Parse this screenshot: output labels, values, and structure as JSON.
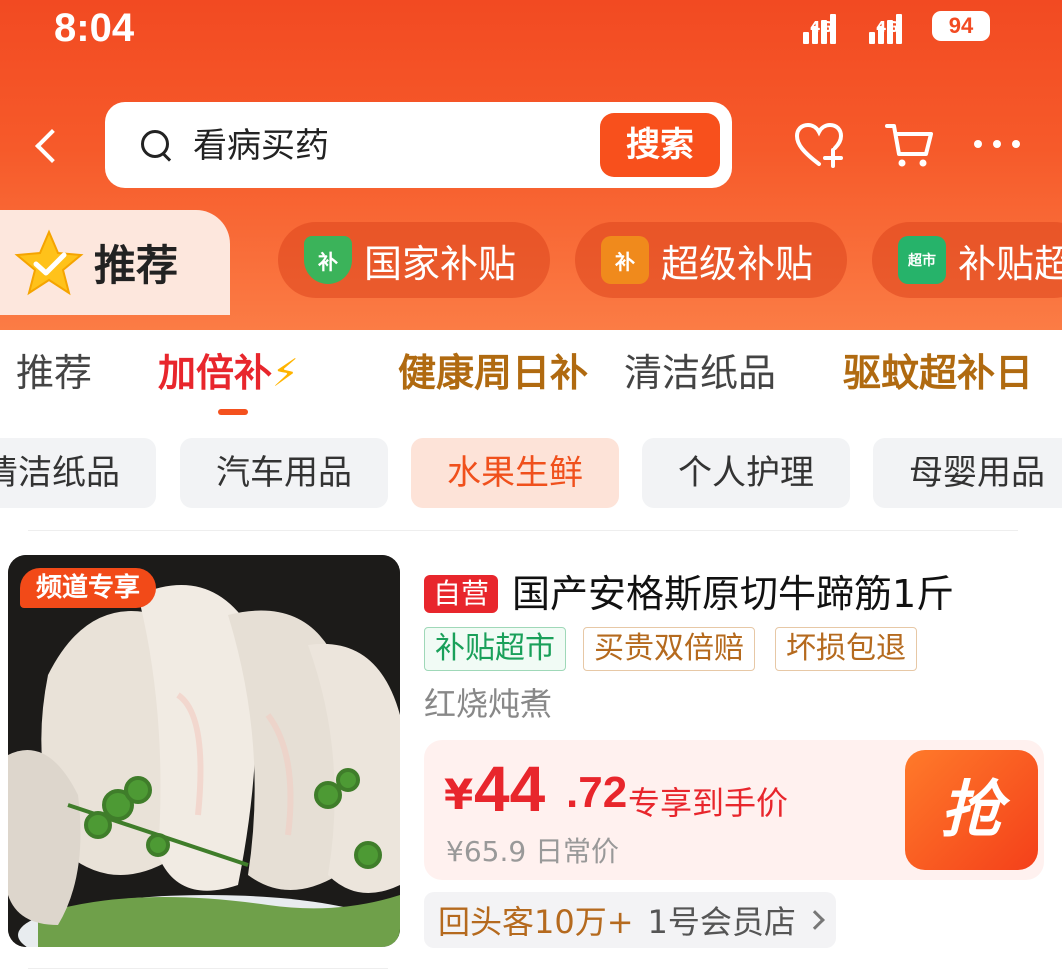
{
  "status": {
    "time": "8:04",
    "network1": "4G",
    "network2": "4G",
    "battery": "94"
  },
  "search": {
    "query": "看病买药",
    "button": "搜索"
  },
  "channels": [
    {
      "label": "推荐",
      "icon": "star-check-icon",
      "active": true
    },
    {
      "label": "国家补贴",
      "icon": "shield-icon",
      "icon_text": "补"
    },
    {
      "label": "超级补贴",
      "icon": "gift-icon",
      "icon_text": "补"
    },
    {
      "label": "补贴超",
      "icon": "basket-icon",
      "icon_text": "超市"
    }
  ],
  "subtabs": [
    {
      "label": "推荐"
    },
    {
      "label": "加倍补"
    },
    {
      "label": "健康周日补"
    },
    {
      "label": "清洁纸品"
    },
    {
      "label": "驱蚊超补日"
    }
  ],
  "chips": [
    {
      "label": "清洁纸品"
    },
    {
      "label": "汽车用品"
    },
    {
      "label": "水果生鲜"
    },
    {
      "label": "个人护理"
    },
    {
      "label": "母婴用品"
    }
  ],
  "product": {
    "channel_badge": "频道专享",
    "self_badge": "自营",
    "title": "国产安格斯原切牛蹄筋1斤",
    "tags": [
      "补贴超市",
      "买贵双倍赔",
      "坏损包退"
    ],
    "subtitle": "红烧炖煮",
    "price_currency": "¥",
    "price_int": "44",
    "price_dec": ".72",
    "price_note": "专享到手价",
    "original_price": "¥65.9 日常价",
    "buy_label": "抢",
    "repeat_customers": "回头客10万+",
    "shop": "1号会员店"
  },
  "colors": {
    "brand": "#f24a22",
    "price": "#e8262c",
    "active_tab": "#e8262c"
  }
}
